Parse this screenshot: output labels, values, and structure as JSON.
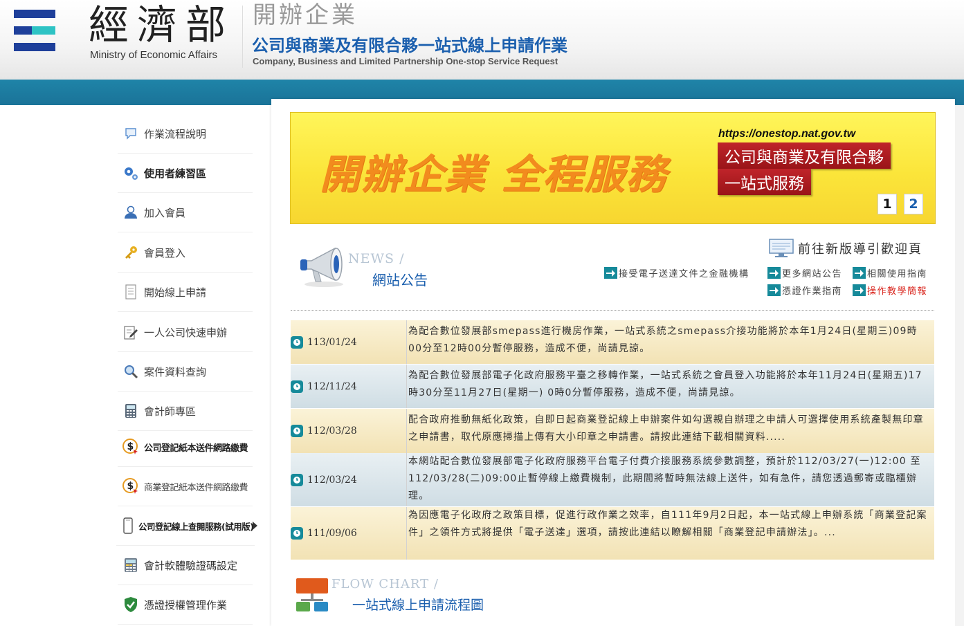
{
  "header": {
    "ministry_zh": "經濟部",
    "ministry_en": "Ministry of Economic Affairs",
    "system_title_gray": "開辦企業",
    "system_title_blue": "公司與商業及有限合夥一站式線上申請作業",
    "system_title_en": "Company, Business and Limited Partnership One-stop Service Request"
  },
  "sidebar": {
    "items": [
      {
        "label": "作業流程說明",
        "icon": "speech-bubble-icon"
      },
      {
        "label": "使用者練習區",
        "icon": "gears-icon"
      },
      {
        "label": "加入會員",
        "icon": "user-icon"
      },
      {
        "label": "會員登入",
        "icon": "key-icon"
      },
      {
        "label": "開始線上申請",
        "icon": "document-icon"
      },
      {
        "label": "一人公司快速申辦",
        "icon": "edit-document-icon"
      },
      {
        "label": "案件資料查詢",
        "icon": "magnifier-icon"
      },
      {
        "label": "會計師專區",
        "icon": "calculator-icon"
      },
      {
        "label": "公司登記紙本送件網路繳費",
        "icon": "dollar-payment-icon"
      },
      {
        "label": "商業登記紙本送件網路繳費",
        "icon": "dollar-payment-icon"
      },
      {
        "label": "公司登記線上查閱服務(試用版)",
        "icon": "phone-icon"
      },
      {
        "label": "會計軟體驗證碼設定",
        "icon": "calculator-icon"
      },
      {
        "label": "憑證授權管理作業",
        "icon": "shield-icon"
      }
    ]
  },
  "banner": {
    "slogan": "開辦企業 全程服務",
    "url": "https://onestop.nat.gov.tw",
    "red_line1": "公司與商業及有限合夥",
    "red_line2": "一站式服務",
    "slides": [
      "1",
      "2"
    ]
  },
  "news": {
    "title_en": "NEWS /",
    "title_zh": "網站公告",
    "new_version_link": "前往新版導引歡迎頁",
    "links": [
      {
        "label": "接受電子送達文件之金融機構",
        "red": false
      },
      {
        "label": "更多網站公告",
        "red": false
      },
      {
        "label": "相關使用指南",
        "red": false
      },
      {
        "label": "憑證作業指南",
        "red": false
      },
      {
        "label": "操作教學簡報",
        "red": true
      }
    ],
    "items": [
      {
        "date": "113/01/24",
        "text": "為配合數位發展部smepass進行機房作業，一站式系統之smepass介接功能將於本年1月24日(星期三)09時00分至12時00分暫停服務，造成不便，尚請見諒。"
      },
      {
        "date": "112/11/24",
        "text": "為配合數位發展部電子化政府服務平臺之移轉作業，一站式系統之會員登入功能將於本年11月24日(星期五)17時30分至11月27日(星期一) 0時0分暫停服務，造成不便，尚請見諒。"
      },
      {
        "date": "112/03/28",
        "text": "配合政府推動無紙化政策，自即日起商業登記線上申辦案件如勾選親自辦理之申請人可選擇使用系統產製無印章之申請書，取代原應掃描上傳有大小印章之申請書。請按此連結下載相關資料....."
      },
      {
        "date": "112/03/24",
        "text": "本網站配合數位發展部電子化政府服務平台電子付費介接服務系統參數調整，預計於112/03/27(一)12:00 至 112/03/28(二)09:00止暫停線上繳費機制，此期間將暫時無法線上送件，如有急件，請您透過郵寄或臨櫃辦理。"
      },
      {
        "date": "111/09/06",
        "text": "為因應電子化政府之政策目標，促進行政作業之效率，自111年9月2日起，本一站式線上申辦系統「商業登記案件」之領件方式將提供「電子送達」選項，請按此連結以瞭解相關「商業登記申請辦法」。..."
      }
    ]
  },
  "flow": {
    "title_en": "FLOW CHART /",
    "title_zh": "一站式線上申請流程圖"
  },
  "colors": {
    "brand_blue": "#1b5fae",
    "band_teal": "#1f84a8",
    "icon_teal": "#168a9a",
    "banner_yellow": "#fbe53a",
    "banner_orange": "#f28b1e",
    "banner_red": "#c0242a",
    "link_red": "#d9251d"
  }
}
